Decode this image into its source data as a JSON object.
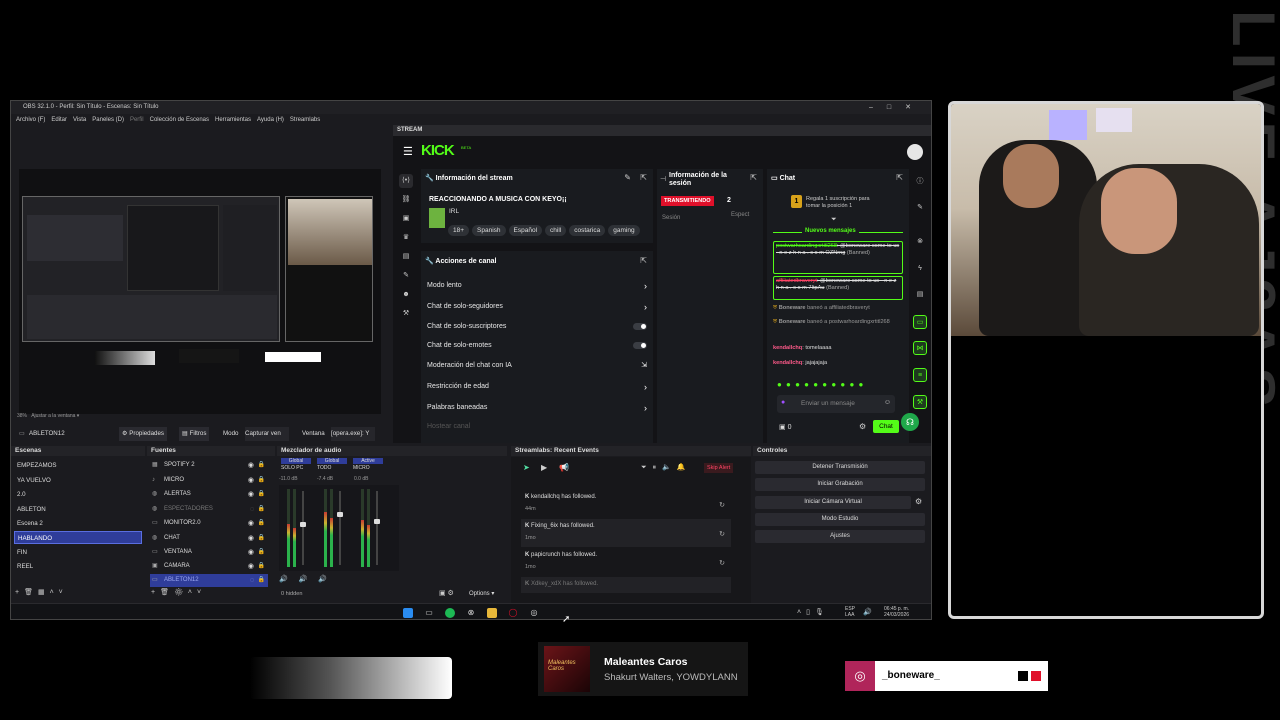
{
  "obs": {
    "title": "OBS 32.1.0 - Perfil: Sin Título - Escenas: Sin Título",
    "menu": [
      "Archivo (F)",
      "Editar",
      "Vista",
      "Paneles (D)",
      "Perfil",
      "Colección de Escenas",
      "Herramientas",
      "Ayuda (H)",
      "Streamlabs"
    ],
    "preview_zoom": "38%",
    "preview_fit": "Ajustar a la ventana",
    "source_toolbar": {
      "source_name": "ABLETON12",
      "properties": "Propiedades",
      "filters": "Filtros",
      "mode_label": "Modo",
      "mode_value": "Capturar ven",
      "window_label": "Ventana",
      "window_value": "[opera.exe]: Y"
    },
    "scenes": {
      "header": "Escenas",
      "items": [
        "EMPEZAMOS",
        "YA VUELVO",
        "2.0",
        "ABLETON",
        "Escena 2",
        "HABLANDO",
        "FIN",
        "REEL"
      ],
      "selected": "HABLANDO"
    },
    "sources": {
      "header": "Fuentes",
      "items": [
        "SPOTIFY 2",
        "MICRO",
        "ALERTAS",
        "ESPECTADORES",
        "MONITOR2.0",
        "CHAT",
        "VENTANA",
        "CAMARA",
        "ABLETON12"
      ]
    },
    "mixer": {
      "header": "Mezclador de audio",
      "tabs": [
        "Global",
        "Global",
        "Active"
      ],
      "channels": [
        {
          "name": "SOLO PC",
          "db": "-11.0 dB",
          "level": 0.55
        },
        {
          "name": "TODO",
          "db": "-7.4 dB",
          "level": 0.7
        },
        {
          "name": "MICRO",
          "db": "0.0 dB",
          "level": 0.6
        }
      ],
      "hidden": "0 hidden",
      "options": "Options"
    },
    "events": {
      "header": "Streamlabs: Recent Events",
      "skip_alert": "Skip Alert",
      "items": [
        {
          "name": "kendallchq",
          "action": "has followed.",
          "time": "44m"
        },
        {
          "name": "Fixing_6ix",
          "action": "has followed.",
          "time": "1mo"
        },
        {
          "name": "papicrunch",
          "action": "has followed.",
          "time": "1mo"
        },
        {
          "name": "Xdkey_xdX",
          "action": "has followed.",
          "time": ""
        }
      ]
    },
    "controls": {
      "header": "Controles",
      "buttons": [
        "Detener Transmisión",
        "Iniciar Grabación",
        "Iniciar Cámara Virtual",
        "Modo Estudio",
        "Ajustes"
      ]
    },
    "taskbar": {
      "lang_top": "ESP",
      "lang_bottom": "LAA",
      "time": "06:45 p. m.",
      "date": "24/03/2026"
    }
  },
  "stream": {
    "dock_label": "STREAM",
    "logo": "KICK",
    "logo_beta": "BETA",
    "info": {
      "header": "Información del stream",
      "title": "REACCIONANDO A MUSICA CON KEYO¡¡",
      "category": "IRL",
      "tags": [
        "18+",
        "Spanish",
        "Español",
        "chill",
        "costarica",
        "gaming"
      ]
    },
    "session": {
      "header": "Información de la sesión",
      "status": "TRANSMITIENDO",
      "count": "2",
      "col1": "Sesión",
      "col2": "Espect"
    },
    "actions": {
      "header": "Acciones de canal",
      "items": [
        {
          "label": "Modo lento",
          "kind": "chev"
        },
        {
          "label": "Chat de solo-seguidores",
          "kind": "chev"
        },
        {
          "label": "Chat de solo-suscriptores",
          "kind": "toggle"
        },
        {
          "label": "Chat de solo-emotes",
          "kind": "toggle"
        },
        {
          "label": "Moderación del chat con IA",
          "kind": "ext"
        },
        {
          "label": "Restricción de edad",
          "kind": "chev"
        },
        {
          "label": "Palabras baneadas",
          "kind": "chev"
        },
        {
          "label": "Hostear canal",
          "kind": "none"
        }
      ]
    },
    "chat": {
      "header": "Chat",
      "gift_text": "Regala 1 suscripción para tomar la posición 1",
      "new_messages": "Nuevos mensajes",
      "messages": [
        {
          "user": "postwarhoardingxrtitl268",
          "text": ": @boneware come to us - n e z h n a . c o m OZNrng",
          "banned": "(Banned)"
        },
        {
          "user": "affiliatedbraveryt",
          "text": ": @boneware come to us - n e z h n a . c o m 7ItpAu",
          "banned": "(Banned)"
        },
        {
          "user": "Boneware",
          "text": "baneó a affiliatedbraveryt",
          "banned": ""
        },
        {
          "user": "Boneware",
          "text": "baneó a postwarhoardingxrtitl268",
          "banned": ""
        },
        {
          "user": "kendallchq",
          "text": ": tomelaaaa",
          "banned": ""
        },
        {
          "user": "kendallchq",
          "text": ": jajajajaja",
          "banned": ""
        }
      ],
      "input_placeholder": "Enviar un mensaje",
      "points": "0",
      "send": "Chat"
    }
  },
  "overlay": {
    "song_title": "Maleantes Caros",
    "song_artist": "Shakurt Walters, YOWDYLANN",
    "album_text": "Maleantes Caros",
    "instagram_handle": "_boneware_",
    "side_text": "LIVE",
    "side_text_2": "AJ3AS"
  },
  "colors": {
    "kick_green": "#53fc18",
    "live_red": "#e0102a",
    "scene_selected": "#2f3d9a"
  }
}
